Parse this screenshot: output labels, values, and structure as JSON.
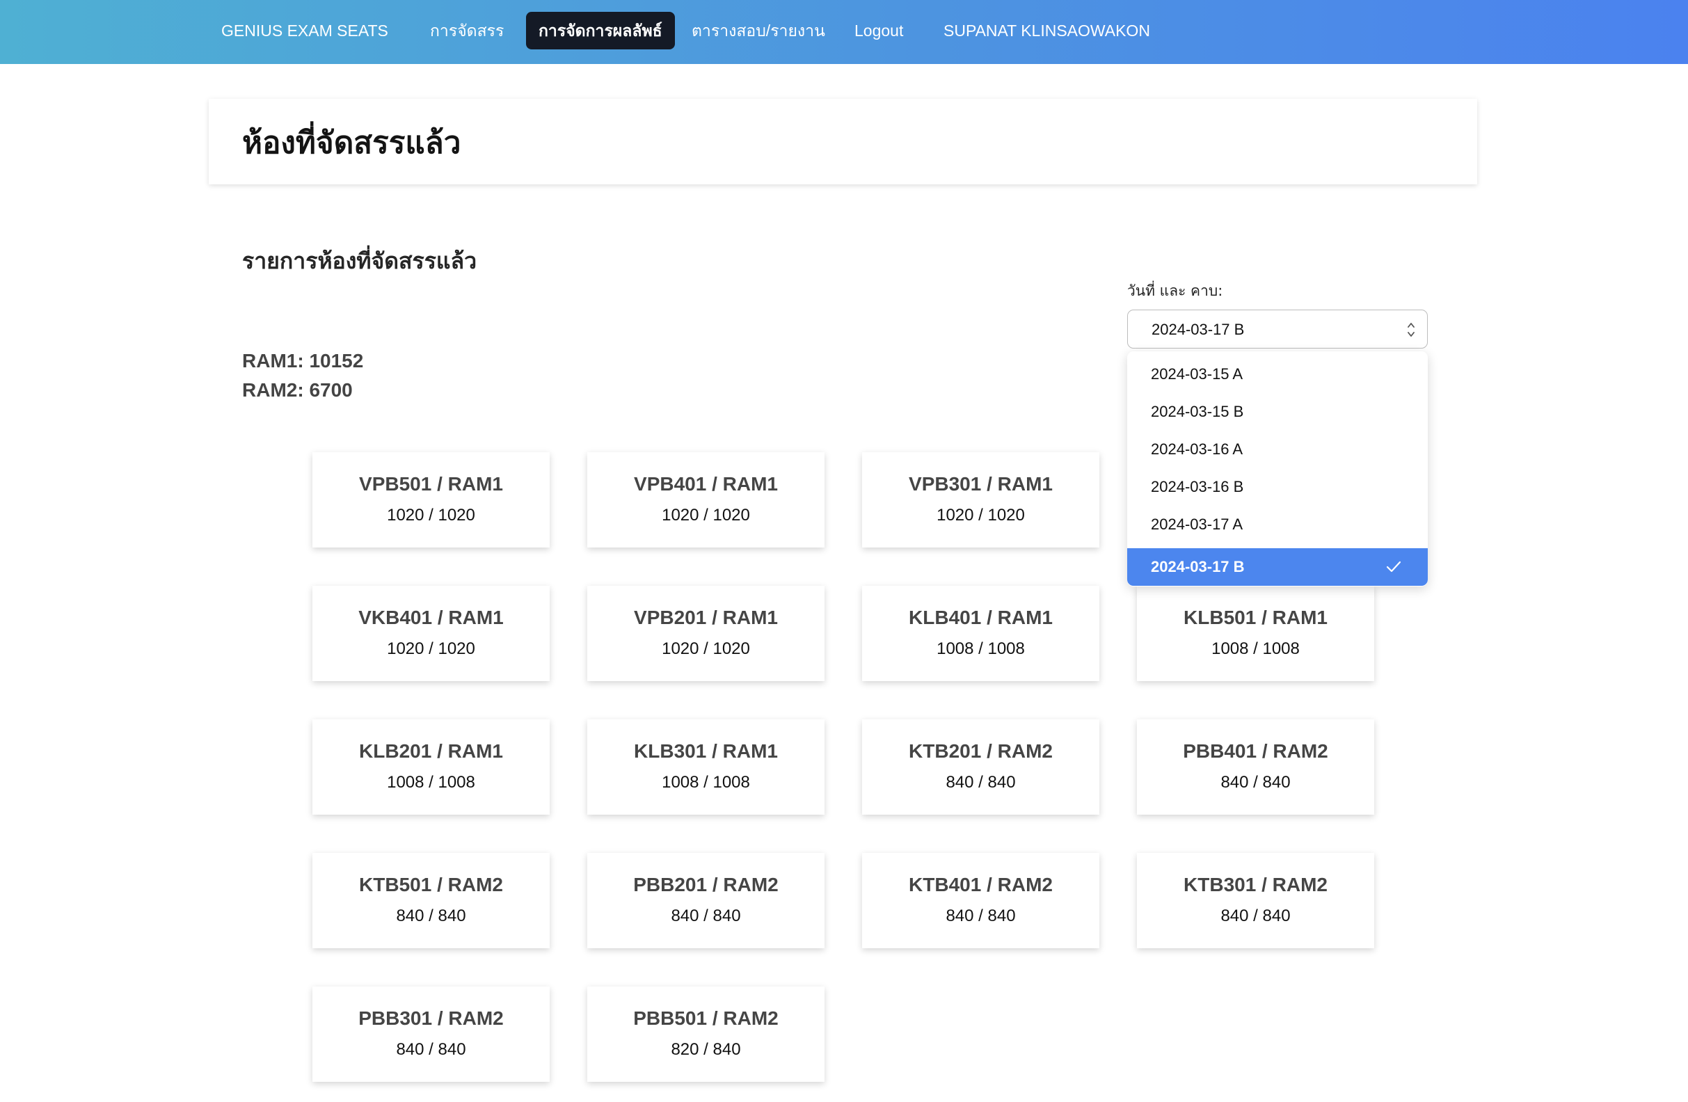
{
  "nav": {
    "brand": "GENIUS EXAM SEATS",
    "allocate": "การจัดสรร",
    "manage_results": "การจัดการผลลัพธ์",
    "schedule_report": "ตารางสอบ/รายงาน",
    "logout": "Logout",
    "user": "SUPANAT KLINSAOWAKON"
  },
  "header": {
    "title": "ห้องที่จัดสรรแล้ว"
  },
  "section": {
    "title": "รายการห้องที่จัดสรรแล้ว"
  },
  "summary": {
    "ram1": "RAM1: 10152",
    "ram2": "RAM2: 6700"
  },
  "select": {
    "label": "วันที่ และ คาบ:",
    "value": "2024-03-17 B",
    "options": [
      "2024-03-15 A",
      "2024-03-15 B",
      "2024-03-16 A",
      "2024-03-16 B",
      "2024-03-17 A",
      "2024-03-17 B"
    ],
    "selected_index": 5
  },
  "rooms": [
    {
      "name": "VPB501 / RAM1",
      "count": "1020 / 1020"
    },
    {
      "name": "VPB401 / RAM1",
      "count": "1020 / 1020"
    },
    {
      "name": "VPB301 / RAM1",
      "count": "1020 / 1020"
    },
    {
      "name": "VKB401 / RAM1",
      "count": "1020 / 1020"
    },
    {
      "name": "VPB201 / RAM1",
      "count": "1020 / 1020"
    },
    {
      "name": "KLB401 / RAM1",
      "count": "1008 / 1008"
    },
    {
      "name": "KLB501 / RAM1",
      "count": "1008 / 1008"
    },
    {
      "name": "KLB201 / RAM1",
      "count": "1008 / 1008"
    },
    {
      "name": "KLB301 / RAM1",
      "count": "1008 / 1008"
    },
    {
      "name": "KTB201 / RAM2",
      "count": "840 / 840"
    },
    {
      "name": "PBB401 / RAM2",
      "count": "840 / 840"
    },
    {
      "name": "KTB501 / RAM2",
      "count": "840 / 840"
    },
    {
      "name": "PBB201 / RAM2",
      "count": "840 / 840"
    },
    {
      "name": "KTB401 / RAM2",
      "count": "840 / 840"
    },
    {
      "name": "KTB301 / RAM2",
      "count": "840 / 840"
    },
    {
      "name": "PBB301 / RAM2",
      "count": "840 / 840"
    },
    {
      "name": "PBB501 / RAM2",
      "count": "820 / 840"
    }
  ],
  "colors": {
    "nav_start": "#4fb0d3",
    "nav_end": "#4b82ef",
    "active_tab": "#141a26",
    "selected_option": "#4c86ee"
  }
}
